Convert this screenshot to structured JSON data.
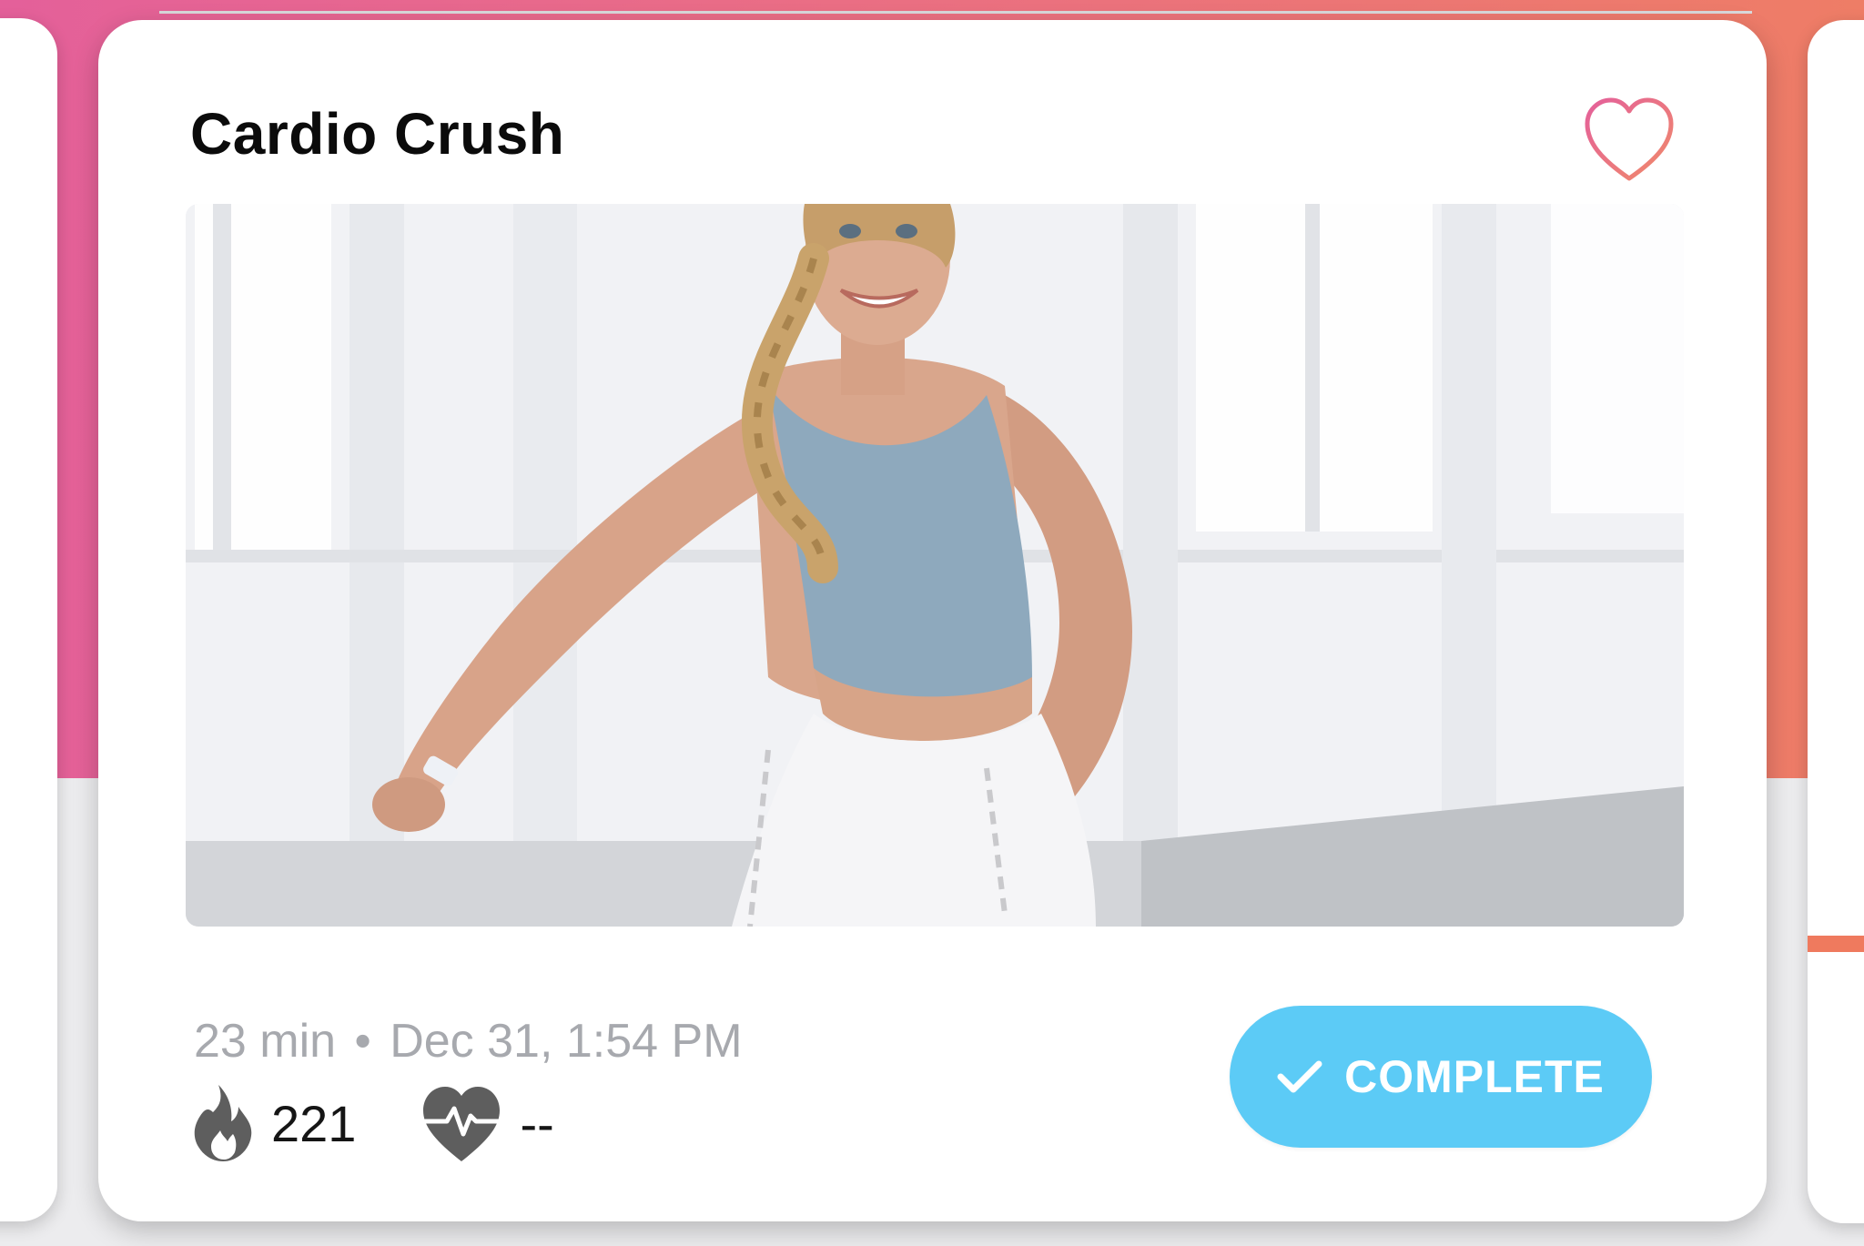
{
  "colors": {
    "brand_pink": "#e4609a",
    "brand_coral": "#ee7d66",
    "complete_button": "#5ccbf6",
    "heart_outline": "#ec6f8f",
    "meta_text": "#a7a9ae",
    "stat_icon": "#5e5e5e"
  },
  "card": {
    "title": "Cardio Crush",
    "favorite_icon": "heart-outline-icon",
    "meta": {
      "duration": "23 min",
      "separator": "•",
      "date": "Dec 31, 1:54 PM"
    },
    "stats": {
      "calories_icon": "flame-icon",
      "calories": "221",
      "heart_rate_icon": "heart-rate-icon",
      "heart_rate": "--"
    },
    "complete_button": {
      "icon": "checkmark-icon",
      "label": "COMPLETE"
    }
  }
}
